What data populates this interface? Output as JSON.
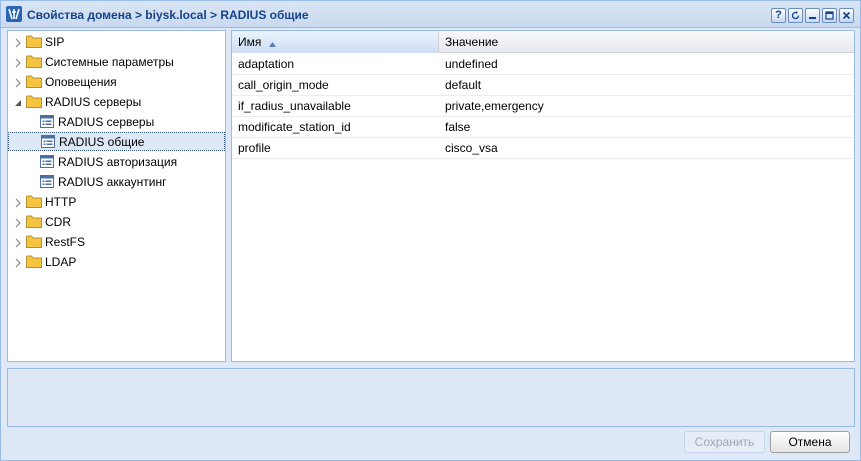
{
  "window": {
    "title": "Свойства домена > biysk.local > RADIUS общие",
    "tools": [
      "help-icon",
      "refresh-icon",
      "minimize-icon",
      "maximize-icon",
      "close-icon"
    ]
  },
  "tree": {
    "items": [
      {
        "label": "SIP",
        "type": "folder",
        "expanded": false
      },
      {
        "label": "Системные параметры",
        "type": "folder",
        "expanded": false
      },
      {
        "label": "Оповещения",
        "type": "folder",
        "expanded": false
      },
      {
        "label": "RADIUS серверы",
        "type": "folder",
        "expanded": true
      },
      {
        "label": "RADIUS серверы",
        "type": "leaf"
      },
      {
        "label": "RADIUS общие",
        "type": "leaf",
        "selected": true
      },
      {
        "label": "RADIUS авторизация",
        "type": "leaf"
      },
      {
        "label": "RADIUS аккаунтинг",
        "type": "leaf"
      },
      {
        "label": "HTTP",
        "type": "folder",
        "expanded": false
      },
      {
        "label": "CDR",
        "type": "folder",
        "expanded": false
      },
      {
        "label": "RestFS",
        "type": "folder",
        "expanded": false
      },
      {
        "label": "LDAP",
        "type": "folder",
        "expanded": false
      }
    ]
  },
  "grid": {
    "columns": {
      "name": "Имя",
      "value": "Значение"
    },
    "rows": [
      {
        "name": "adaptation",
        "value": "undefined"
      },
      {
        "name": "call_origin_mode",
        "value": "default"
      },
      {
        "name": "if_radius_unavailable",
        "value": "private,emergency"
      },
      {
        "name": "modificate_station_id",
        "value": "false"
      },
      {
        "name": "profile",
        "value": "cisco_vsa"
      }
    ]
  },
  "buttons": {
    "save": "Сохранить",
    "cancel": "Отмена"
  },
  "colors": {
    "accent": "#15428b",
    "border": "#99bbe8",
    "panel": "#dfe8f6",
    "folder": "#f5c542"
  }
}
